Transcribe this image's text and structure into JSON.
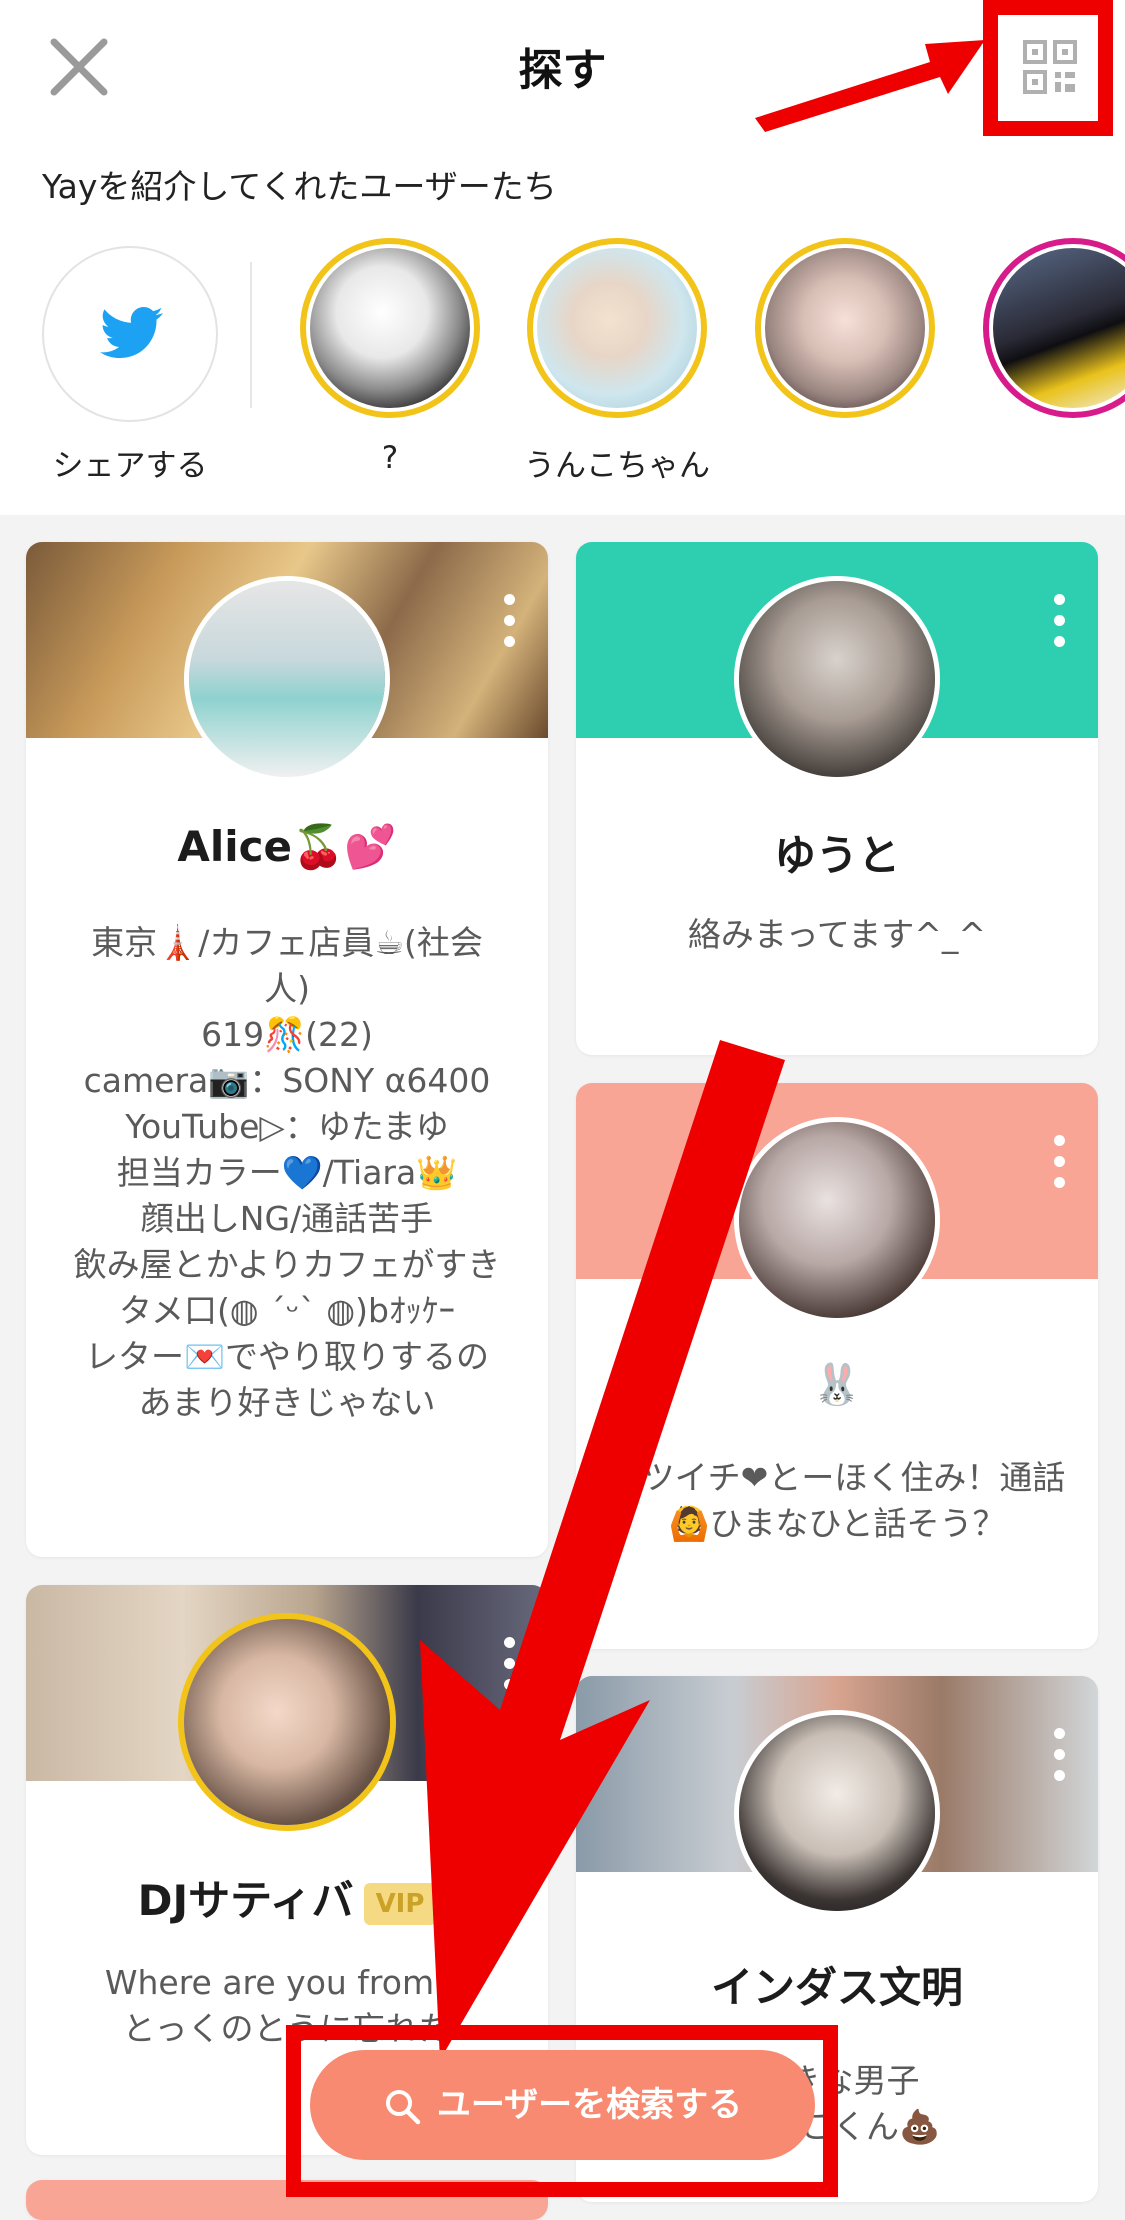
{
  "header": {
    "title": "探す",
    "intro_title": "Yayを紹介してくれたユーザーたち"
  },
  "stories": [
    {
      "label": "シェアする",
      "icon": "twitter-icon"
    },
    {
      "label": "?"
    },
    {
      "label": "うんこちゃん"
    },
    {
      "label": ""
    },
    {
      "label": ""
    }
  ],
  "cards": [
    {
      "name": "Alice🍒💕",
      "bio": "東京🗼/カフェ店員☕(社会\n人)\n619🎊(22)\ncamera📷：SONY α6400\nYouTube▷：ゆたまゆ\n担当カラー💙/Tiara👑\n顔出しNG/通話苦手\n飲み屋とかよりカフェがすき\nタメ口(◍ ´ᵕ` ◍)bｵｯｹｰ\nレター💌でやり取りするの\nあまり好きじゃない"
    },
    {
      "name": "ゆうと",
      "bio": "絡みまってます^_^"
    },
    {
      "name": "🐰",
      "bio": "バツイチ❤とーほく住み！通話\n🙆ひまなひと話そう？"
    },
    {
      "name": "DJサティバ",
      "badge": "VIP",
      "bio": "Where are you from??\nとっくのとうに忘れた"
    },
    {
      "name": "インダス文明",
      "bio": "好きな男子\nうんこくん💩"
    }
  ],
  "search_button": {
    "label": "ユーザーを検索する"
  },
  "colors": {
    "accent": "#f78a70",
    "annotation": "#ee0000",
    "teal": "#2ecfb1",
    "salmon": "#f8a596",
    "gold": "#f2c318"
  }
}
